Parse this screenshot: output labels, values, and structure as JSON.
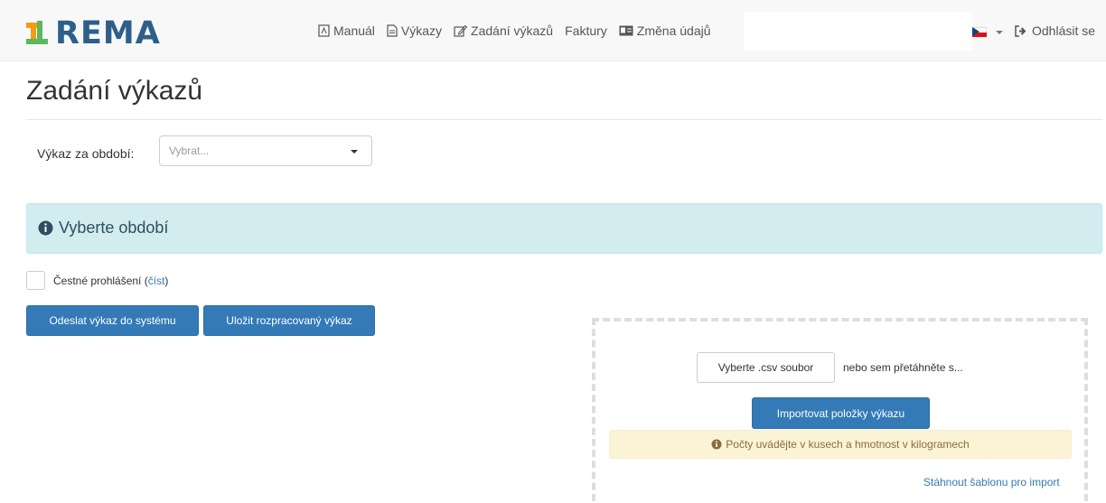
{
  "app": {
    "logo_text": "REMA"
  },
  "nav": {
    "items": [
      {
        "label": "Manuál",
        "icon": "pdf-file-icon"
      },
      {
        "label": "Výkazy",
        "icon": "file-text-icon"
      },
      {
        "label": "Zadání výkazů",
        "icon": "edit-icon"
      },
      {
        "label": "Faktury",
        "icon": ""
      },
      {
        "label": "Změna údajů",
        "icon": "id-card-icon"
      }
    ],
    "language_flag": "czech-flag-icon",
    "logout_label": "Odhlásit se"
  },
  "page": {
    "title": "Zadání výkazů"
  },
  "period": {
    "label": "Výkaz za období:",
    "placeholder": "Vybrat..."
  },
  "alert_info": {
    "text": "Vyberte období"
  },
  "declaration": {
    "label": "Čestné prohlášení",
    "open_paren": "(",
    "link_text": "číst",
    "close_paren": ")"
  },
  "buttons": {
    "send": "Odeslat výkaz do systému",
    "save": "Uložit rozpracovaný výkaz"
  },
  "import": {
    "file_button": "Vyberte .csv soubor",
    "hint": "nebo sem přetáhněte s...",
    "import_button": "Importovat položky výkazu",
    "warning": "Počty uvádějte v kusech a hmotnost v kilogramech",
    "template_link": "Stáhnout šablonu pro import"
  },
  "colors": {
    "primary": "#337ab7",
    "info_bg": "#d2ecf0",
    "warning_bg": "#fbf3d6",
    "logo_orange": "#f39c12",
    "logo_green": "#5cb85c"
  }
}
